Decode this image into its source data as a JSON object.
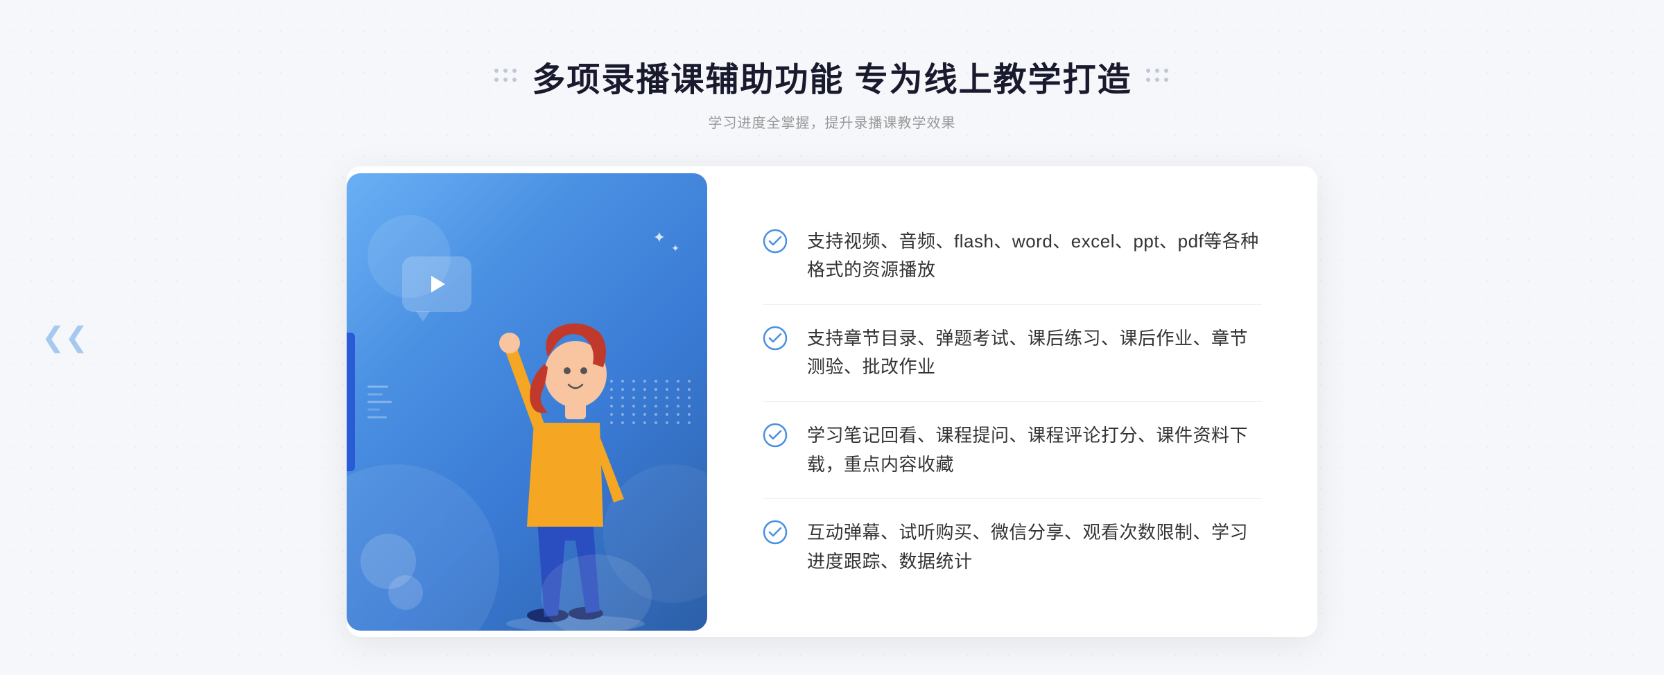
{
  "header": {
    "title": "多项录播课辅助功能 专为线上教学打造",
    "subtitle": "学习进度全掌握，提升录播课教学效果",
    "decoration_left": "❋",
    "decoration_right": "❋"
  },
  "features": [
    {
      "id": 1,
      "text": "支持视频、音频、flash、word、excel、ppt、pdf等各种格式的资源播放"
    },
    {
      "id": 2,
      "text": "支持章节目录、弹题考试、课后练习、课后作业、章节测验、批改作业"
    },
    {
      "id": 3,
      "text": "学习笔记回看、课程提问、课程评论打分、课件资料下载，重点内容收藏"
    },
    {
      "id": 4,
      "text": "互动弹幕、试听购买、微信分享、观看次数限制、学习进度跟踪、数据统计"
    }
  ],
  "colors": {
    "blue_gradient_start": "#6ab0f5",
    "blue_gradient_end": "#3a7bd5",
    "check_color": "#4a90e2",
    "title_color": "#1a1a2e",
    "text_color": "#333333"
  }
}
